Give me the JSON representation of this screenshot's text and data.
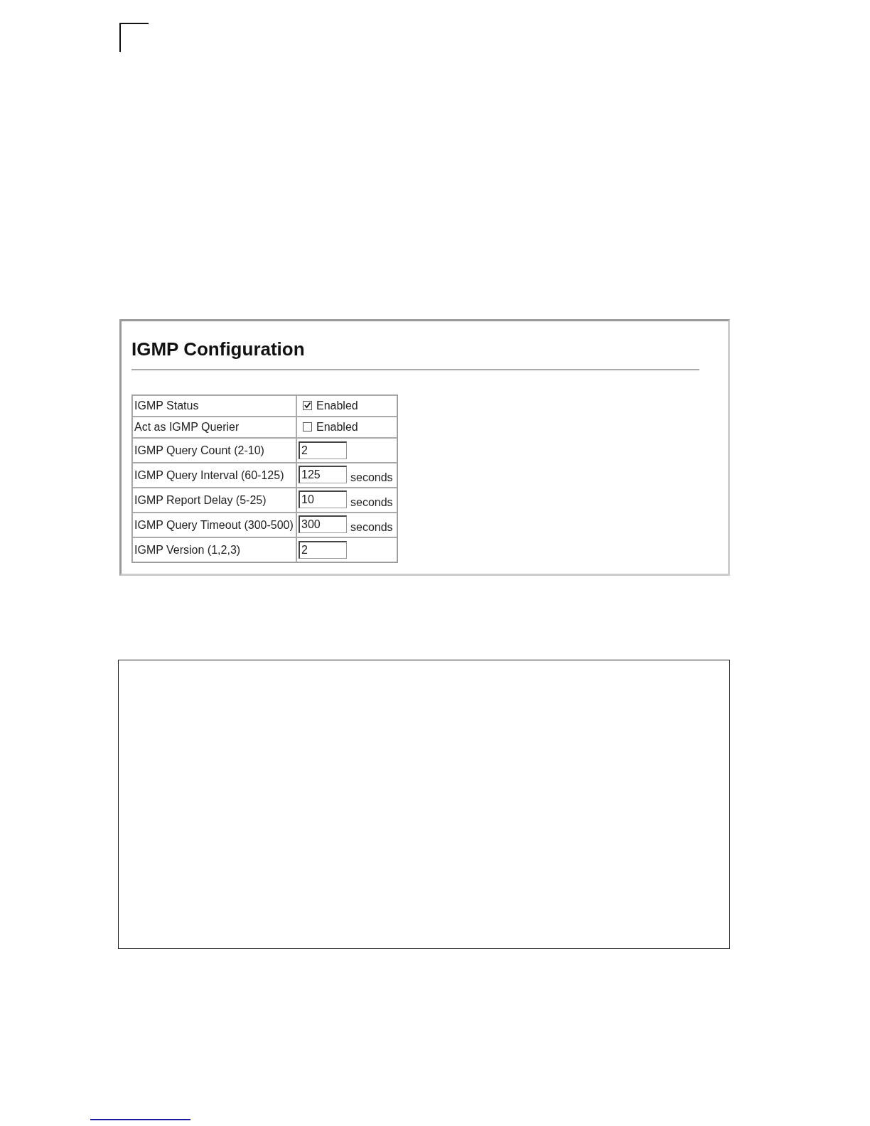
{
  "panel": {
    "title": "IGMP Configuration",
    "rows": [
      {
        "kind": "checkbox",
        "label": "IGMP Status",
        "checked": true,
        "option": "Enabled"
      },
      {
        "kind": "checkbox",
        "label": "Act as IGMP Querier",
        "checked": false,
        "option": "Enabled"
      },
      {
        "kind": "number",
        "label": "IGMP Query Count (2-10)",
        "value": "2"
      },
      {
        "kind": "number",
        "label": "IGMP Query Interval (60-125)",
        "value": "125",
        "unit": "seconds"
      },
      {
        "kind": "number",
        "label": "IGMP Report Delay (5-25)",
        "value": "10",
        "unit": "seconds"
      },
      {
        "kind": "number",
        "label": "IGMP Query Timeout (300-500)",
        "value": "300",
        "unit": "seconds"
      },
      {
        "kind": "number",
        "label": "IGMP Version (1,2,3)",
        "value": "2"
      }
    ]
  }
}
